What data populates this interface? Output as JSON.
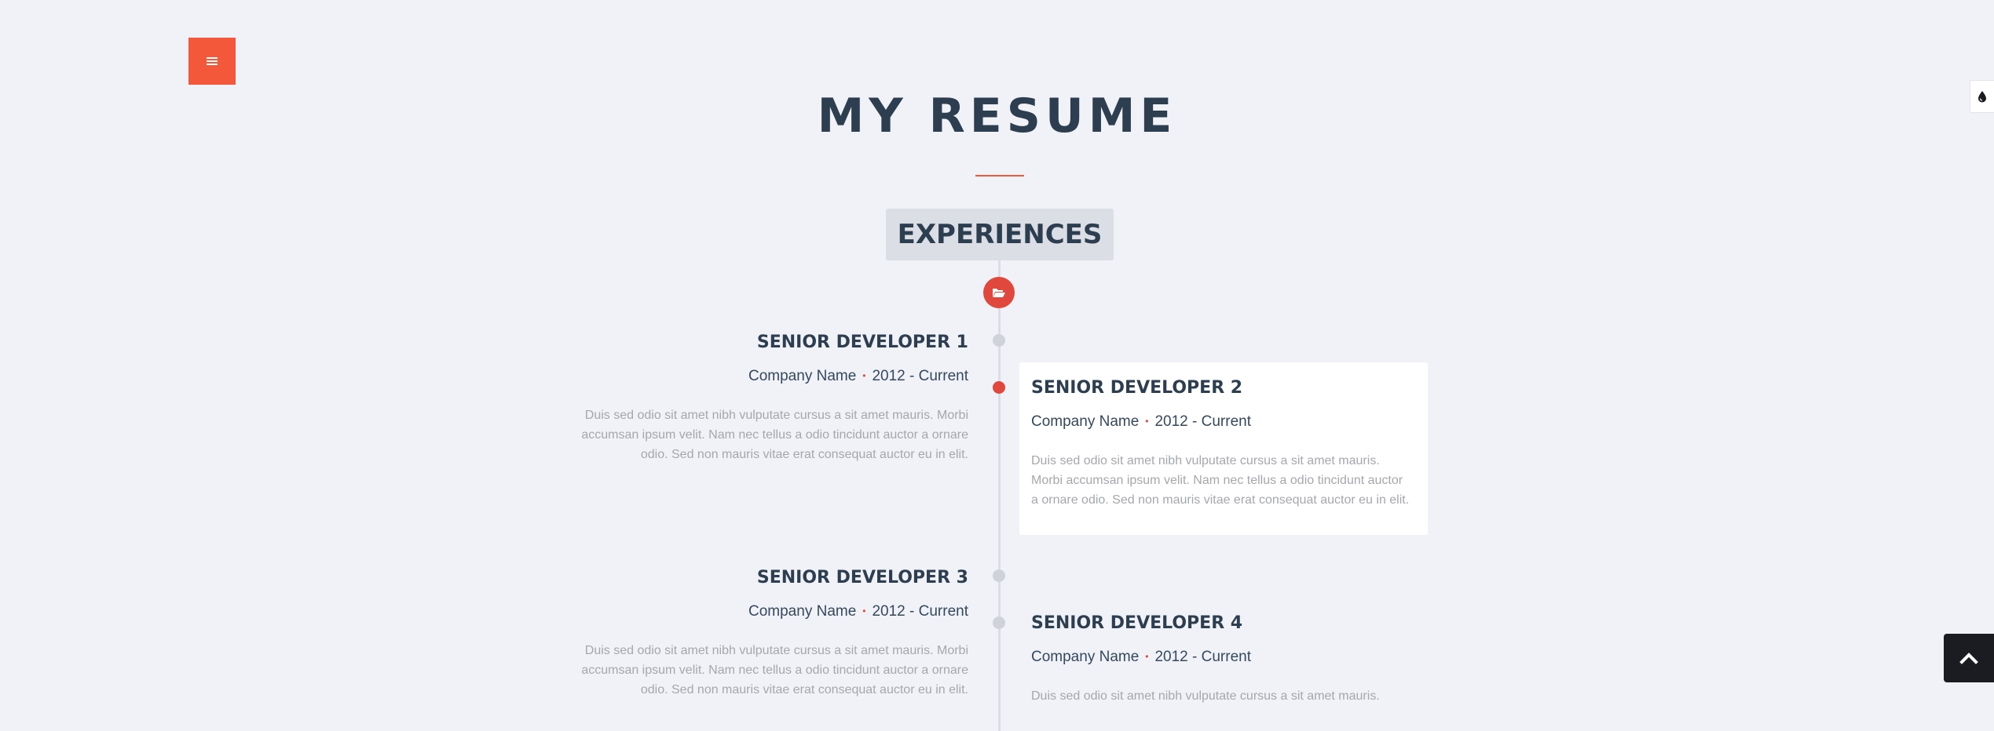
{
  "header": {
    "menu_icon": "hamburger-icon",
    "theme_icon": "ink-drop-icon",
    "title": "MY RESUME"
  },
  "section": {
    "label": "EXPERIENCES",
    "icon": "folder-open-icon"
  },
  "entries": [
    {
      "title": "SENIOR DEVELOPER 1",
      "company": "Company Name",
      "period": "2012 - Current",
      "description": "Duis sed odio sit amet nibh vulputate cursus a sit amet mauris. Morbi accumsan ipsum velit. Nam nec tellus a odio tincidunt auctor a ornare odio. Sed non mauris vitae erat consequat auctor eu in elit."
    },
    {
      "title": "SENIOR DEVELOPER 2",
      "company": "Company Name",
      "period": "2012 - Current",
      "description": "Duis sed odio sit amet nibh vulputate cursus a sit amet mauris. Morbi accumsan ipsum velit. Nam nec tellus a odio tincidunt auctor a ornare odio. Sed non mauris vitae erat consequat auctor eu in elit."
    },
    {
      "title": "SENIOR DEVELOPER 3",
      "company": "Company Name",
      "period": "2012 - Current",
      "description": "Duis sed odio sit amet nibh vulputate cursus a sit amet mauris. Morbi accumsan ipsum velit. Nam nec tellus a odio tincidunt auctor a ornare odio. Sed non mauris vitae erat consequat auctor eu in elit."
    },
    {
      "title": "SENIOR DEVELOPER 4",
      "company": "Company Name",
      "period": "2012 - Current",
      "description": "Duis sed odio sit amet nibh vulputate cursus a sit amet mauris."
    }
  ],
  "separator": "•",
  "back_to_top_icon": "chevron-up-icon",
  "colors": {
    "accent": "#f4583a",
    "timeline_active": "#e0483d",
    "heading": "#2c3e50",
    "background": "#f1f2f7"
  }
}
